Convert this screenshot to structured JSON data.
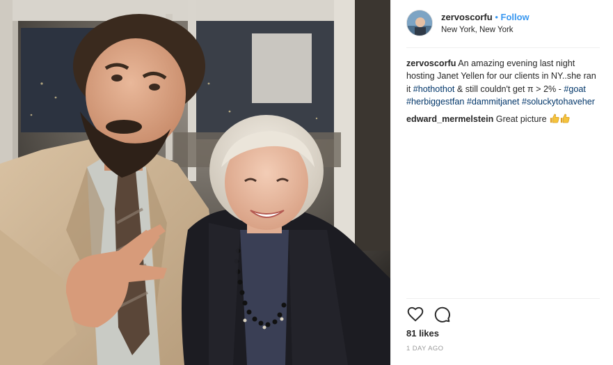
{
  "post": {
    "username": "zervoscorfu",
    "separator": "•",
    "follow_label": "Follow",
    "location": "New York, New York",
    "caption": {
      "username": "zervoscorfu",
      "text1": "An amazing evening last night hosting Janet Yellen for our clients in NY..she ran it ",
      "tag1": "#hothothot",
      "text2": " & still couldn't get π > 2% - ",
      "tag2": "#goat",
      "tag3": "#herbiggestfan",
      "tag4": "#dammitjanet",
      "tag5": "#soluckytohaveher"
    },
    "comment": {
      "username": "edward_mermelstein",
      "text": "Great picture"
    },
    "likes_text": "81 likes",
    "time_ago": "1 DAY AGO"
  },
  "icons": {
    "like": "heart-outline-icon",
    "comment": "speech-bubble-icon",
    "emoji": "thumbs-up-emoji"
  },
  "colors": {
    "link_blue": "#3897f0",
    "hashtag": "#003569",
    "muted": "#999999",
    "text": "#262626"
  }
}
